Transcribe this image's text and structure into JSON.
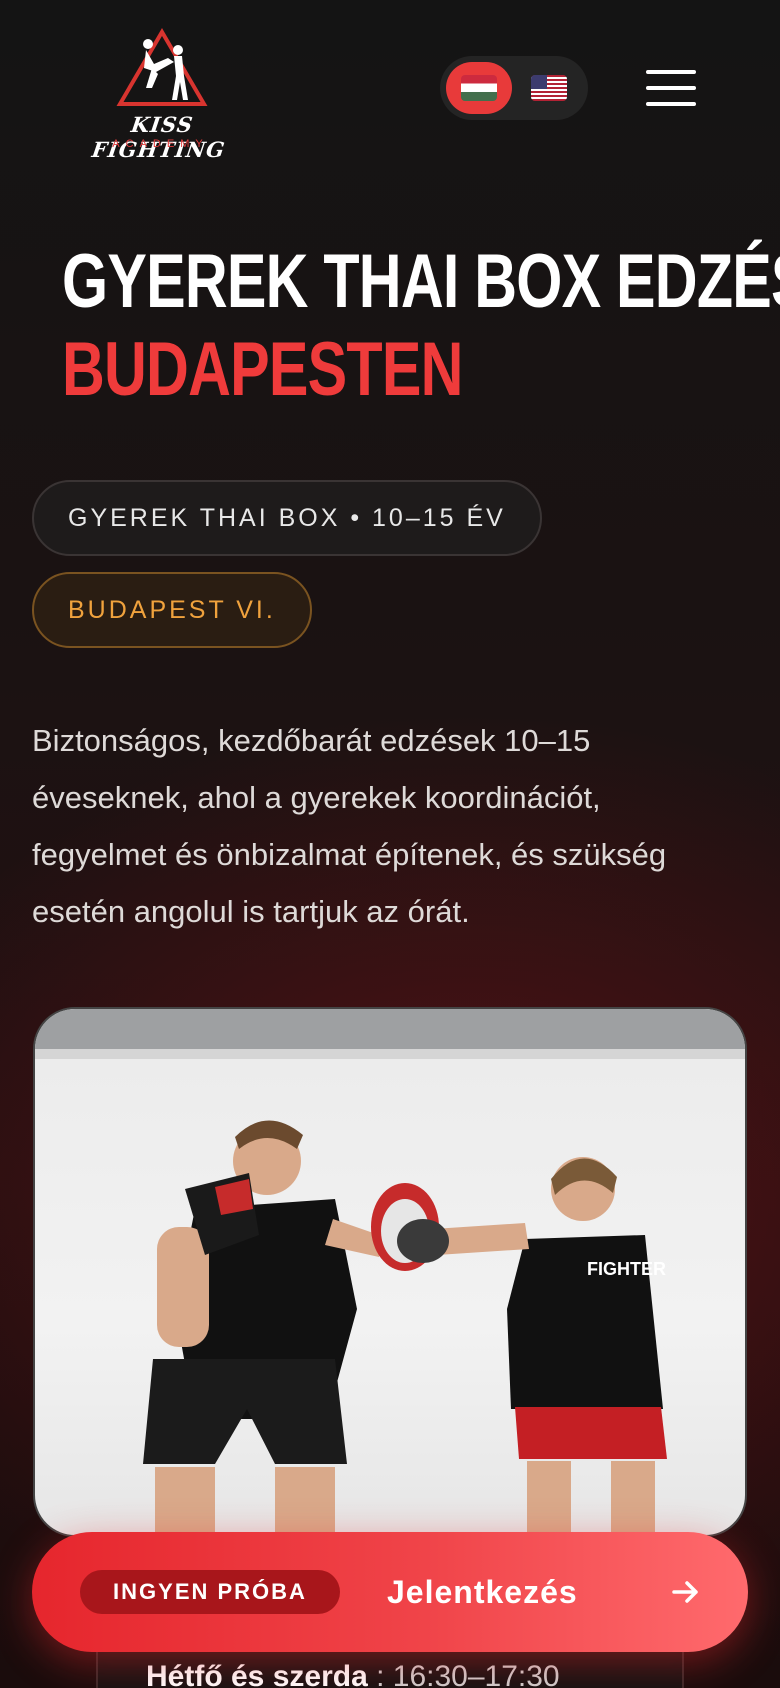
{
  "header": {
    "logo": {
      "title": "KISS FIGHTING",
      "subtitle": "ACADEMY"
    },
    "language_switch": {
      "options": [
        {
          "code": "hu",
          "flag": "hungary-flag-icon",
          "active": true
        },
        {
          "code": "en",
          "flag": "usa-flag-icon",
          "active": false
        }
      ],
      "active_color": "#e83a3a"
    },
    "menu_icon": "hamburger-menu-icon"
  },
  "hero": {
    "title_line1": "GYEREK THAI BOX EDZÉS",
    "title_line2": "BUDAPESTEN",
    "accent_color": "#ef3b3b",
    "chips": {
      "age": "GYEREK THAI BOX • 10–15 ÉV",
      "location": "BUDAPEST VI."
    },
    "description": "Biztonságos, kezdőbarát edzések 10–15 éveseknek, ahol a gyerekek koordinációt, fegyelmet és önbizalmat építenek, és szükség esetén angolul is tartjuk az órát."
  },
  "photo": {
    "subject": "coach holding focus mitts for a young boxer",
    "shirt_print": "FIGHTER"
  },
  "schedule": {
    "days": "Hétfő és szerda",
    "time": ": 16:30–17:30"
  },
  "cta": {
    "badge": "INGYEN PRÓBA",
    "label": "Jelentkezés",
    "icon": "arrow-right-icon",
    "color": "#e6262d"
  }
}
